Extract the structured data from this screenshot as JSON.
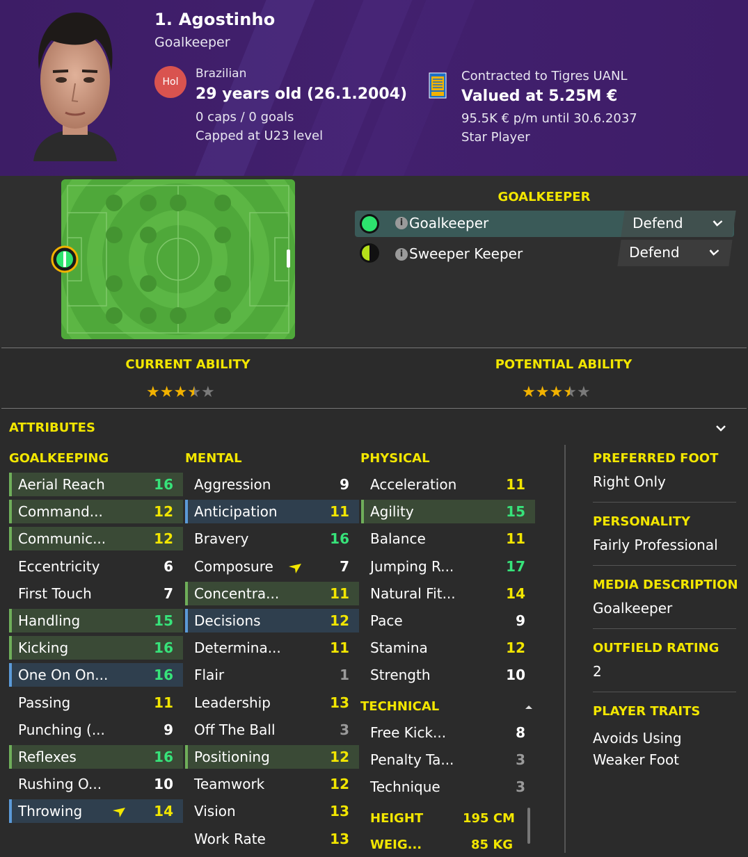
{
  "header": {
    "name": "1. Agostinho",
    "position": "Goalkeeper",
    "nationality_badge": "Hol",
    "nationality": "Brazilian",
    "age": "29 years old (26.1.2004)",
    "caps": "0 caps / 0 goals",
    "capped_level": "Capped at U23 level",
    "contract": "Contracted to Tigres UANL",
    "value": "Valued at 5.25M €",
    "wage": "95.5K € p/m until 30.6.2037",
    "status": "Star Player"
  },
  "roles": {
    "title": "GOALKEEPER",
    "items": [
      {
        "name": "Goalkeeper",
        "duty": "Defend"
      },
      {
        "name": "Sweeper Keeper",
        "duty": "Defend"
      }
    ]
  },
  "ability": {
    "current_title": "CURRENT ABILITY",
    "current_stars": 3.5,
    "potential_title": "POTENTIAL ABILITY",
    "potential_stars": 3.5
  },
  "attributes": {
    "title": "ATTRIBUTES",
    "goalkeeping": {
      "title": "GOALKEEPING",
      "items": [
        {
          "label": "Aerial Reach",
          "value": "16"
        },
        {
          "label": "Command...",
          "value": "12"
        },
        {
          "label": "Communic...",
          "value": "12"
        },
        {
          "label": "Eccentricity",
          "value": "6"
        },
        {
          "label": "First Touch",
          "value": "7"
        },
        {
          "label": "Handling",
          "value": "15"
        },
        {
          "label": "Kicking",
          "value": "16"
        },
        {
          "label": "One On On...",
          "value": "16"
        },
        {
          "label": "Passing",
          "value": "11"
        },
        {
          "label": "Punching (...",
          "value": "9"
        },
        {
          "label": "Reflexes",
          "value": "16"
        },
        {
          "label": "Rushing O...",
          "value": "10"
        },
        {
          "label": "Throwing",
          "value": "14"
        }
      ]
    },
    "mental": {
      "title": "MENTAL",
      "items": [
        {
          "label": "Aggression",
          "value": "9"
        },
        {
          "label": "Anticipation",
          "value": "11"
        },
        {
          "label": "Bravery",
          "value": "16"
        },
        {
          "label": "Composure",
          "value": "7"
        },
        {
          "label": "Concentra...",
          "value": "11"
        },
        {
          "label": "Decisions",
          "value": "12"
        },
        {
          "label": "Determina...",
          "value": "11"
        },
        {
          "label": "Flair",
          "value": "1"
        },
        {
          "label": "Leadership",
          "value": "13"
        },
        {
          "label": "Off The Ball",
          "value": "3"
        },
        {
          "label": "Positioning",
          "value": "12"
        },
        {
          "label": "Teamwork",
          "value": "12"
        },
        {
          "label": "Vision",
          "value": "13"
        },
        {
          "label": "Work Rate",
          "value": "13"
        }
      ]
    },
    "physical": {
      "title": "PHYSICAL",
      "items": [
        {
          "label": "Acceleration",
          "value": "11"
        },
        {
          "label": "Agility",
          "value": "15"
        },
        {
          "label": "Balance",
          "value": "11"
        },
        {
          "label": "Jumping R...",
          "value": "17"
        },
        {
          "label": "Natural Fit...",
          "value": "14"
        },
        {
          "label": "Pace",
          "value": "9"
        },
        {
          "label": "Stamina",
          "value": "12"
        },
        {
          "label": "Strength",
          "value": "10"
        }
      ]
    },
    "technical": {
      "title": "TECHNICAL",
      "items": [
        {
          "label": "Free Kick...",
          "value": "8"
        },
        {
          "label": "Penalty Ta...",
          "value": "3"
        },
        {
          "label": "Technique",
          "value": "3"
        }
      ]
    },
    "height_label": "HEIGHT",
    "height_value": "195 CM",
    "weight_label": "WEIG...",
    "weight_value": "85 KG"
  },
  "side": {
    "foot_title": "PREFERRED FOOT",
    "foot_value": "Right Only",
    "personality_title": "PERSONALITY",
    "personality_value": "Fairly Professional",
    "media_title": "MEDIA DESCRIPTION",
    "media_value": "Goalkeeper",
    "outfield_title": "OUTFIELD RATING",
    "outfield_value": "2",
    "traits_title": "PLAYER TRAITS",
    "traits_value_1": "Avoids Using",
    "traits_value_2": "Weaker Foot"
  },
  "colors": {
    "header_bg": "#3d1d66",
    "accent_yellow": "#f2e600",
    "value_green": "#37e37a",
    "pitch_green": "#4fa83a"
  }
}
